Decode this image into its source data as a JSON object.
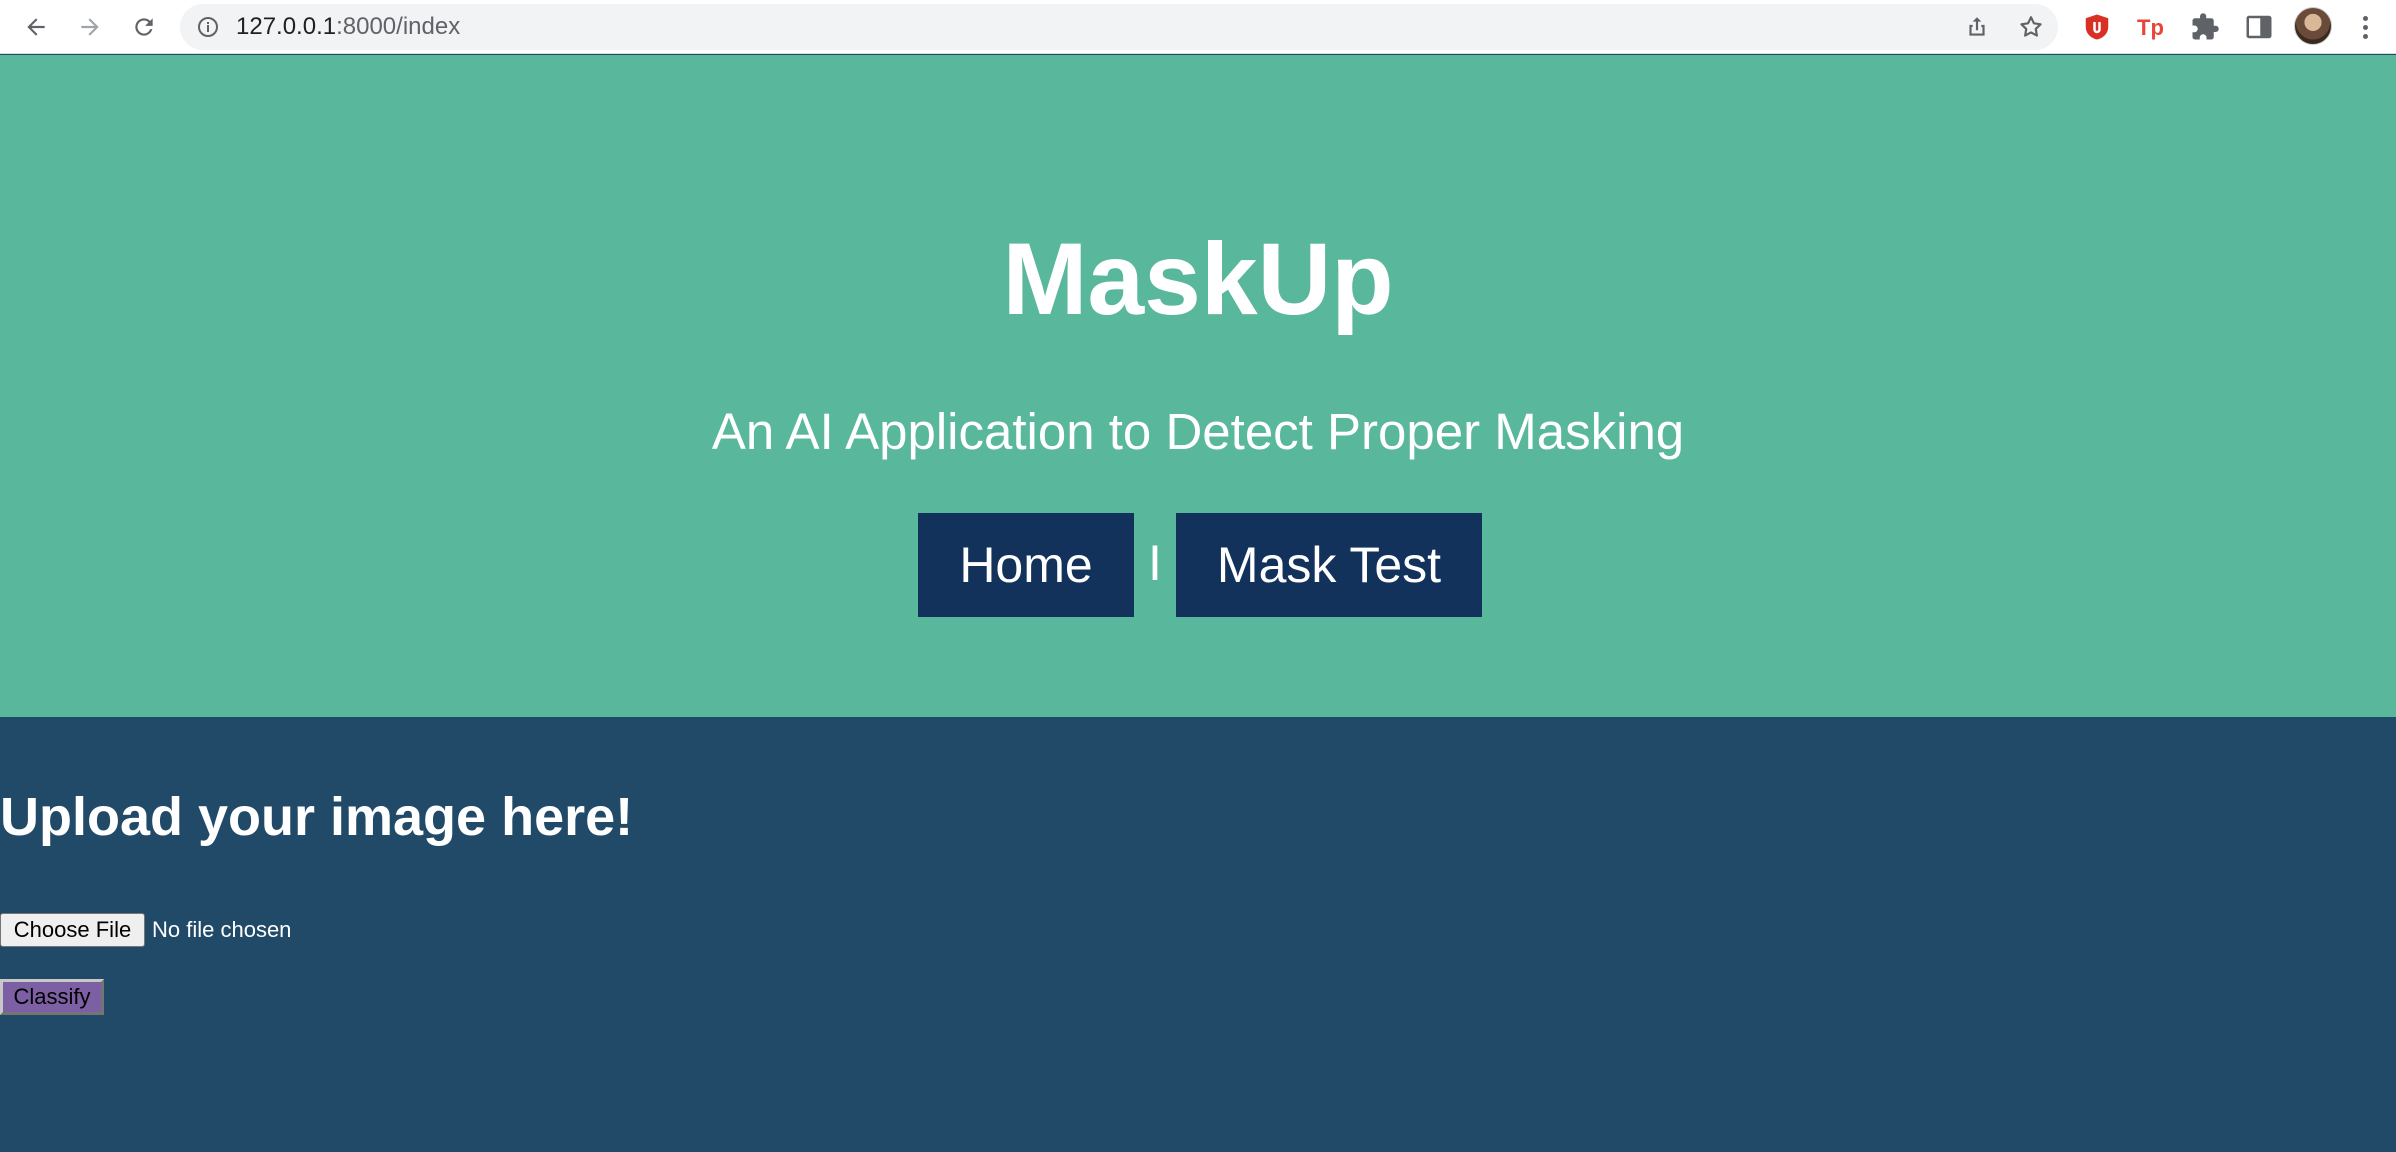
{
  "browser": {
    "url_host": "127.0.0.1",
    "url_rest": ":8000/index",
    "icons": [
      "back-arrow-icon",
      "forward-arrow-icon",
      "reload-icon",
      "site-info-icon",
      "share-icon",
      "bookmark-star-icon",
      "ublock-extension-icon",
      "tp-extension-icon",
      "puzzle-extensions-icon",
      "side-panel-icon",
      "profile-avatar",
      "menu-kebab-icon"
    ],
    "tp_extension_label": "Tp"
  },
  "hero": {
    "title": "MaskUp",
    "subtitle": "An AI Application to Detect Proper Masking",
    "nav": {
      "home_label": "Home",
      "separator": "I",
      "mask_test_label": "Mask Test"
    }
  },
  "main": {
    "heading": "Upload your image here!",
    "file_input": {
      "button_label": "Choose File",
      "status": "No file chosen"
    },
    "classify_label": "Classify"
  },
  "colors": {
    "hero_bg": "#59b89c",
    "main_bg": "#214a68",
    "nav_button_bg": "#12325c",
    "classify_bg": "#7d5fa3"
  }
}
